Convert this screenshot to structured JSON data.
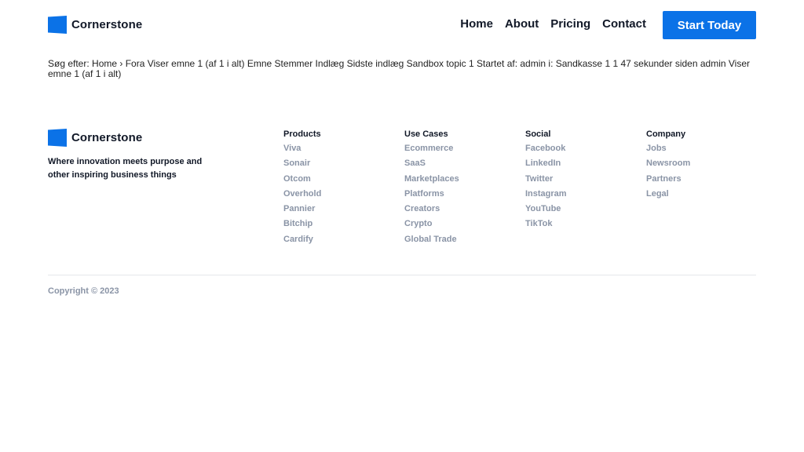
{
  "brand": {
    "name": "Cornerstone",
    "color": "#0b72e7"
  },
  "nav": {
    "items": [
      "Home",
      "About",
      "Pricing",
      "Contact"
    ]
  },
  "cta": {
    "label": "Start Today"
  },
  "content": {
    "line": "Søg efter: Home › Fora Viser emne 1 (af 1 i alt) Emne Stemmer Indlæg Sidste indlæg Sandbox topic 1 Startet af: admin i: Sandkasse 1 1 47 sekunder siden admin   Viser emne 1 (af 1 i alt)"
  },
  "footer": {
    "tagline": "Where innovation meets purpose and other inspiring business things",
    "columns": [
      {
        "title": "Products",
        "items": [
          "Viva",
          "Sonair",
          "Otcom",
          "Overhold",
          "Pannier",
          "Bitchip",
          "Cardify"
        ]
      },
      {
        "title": "Use Cases",
        "items": [
          "Ecommerce",
          "SaaS",
          "Marketplaces",
          "Platforms",
          "Creators",
          "Crypto",
          "Global Trade"
        ]
      },
      {
        "title": "Social",
        "items": [
          "Facebook",
          "LinkedIn",
          "Twitter",
          "Instagram",
          "YouTube",
          "TikTok"
        ]
      },
      {
        "title": "Company",
        "items": [
          "Jobs",
          "Newsroom",
          "Partners",
          "Legal"
        ]
      }
    ],
    "copyright": "Copyright © 2023"
  }
}
